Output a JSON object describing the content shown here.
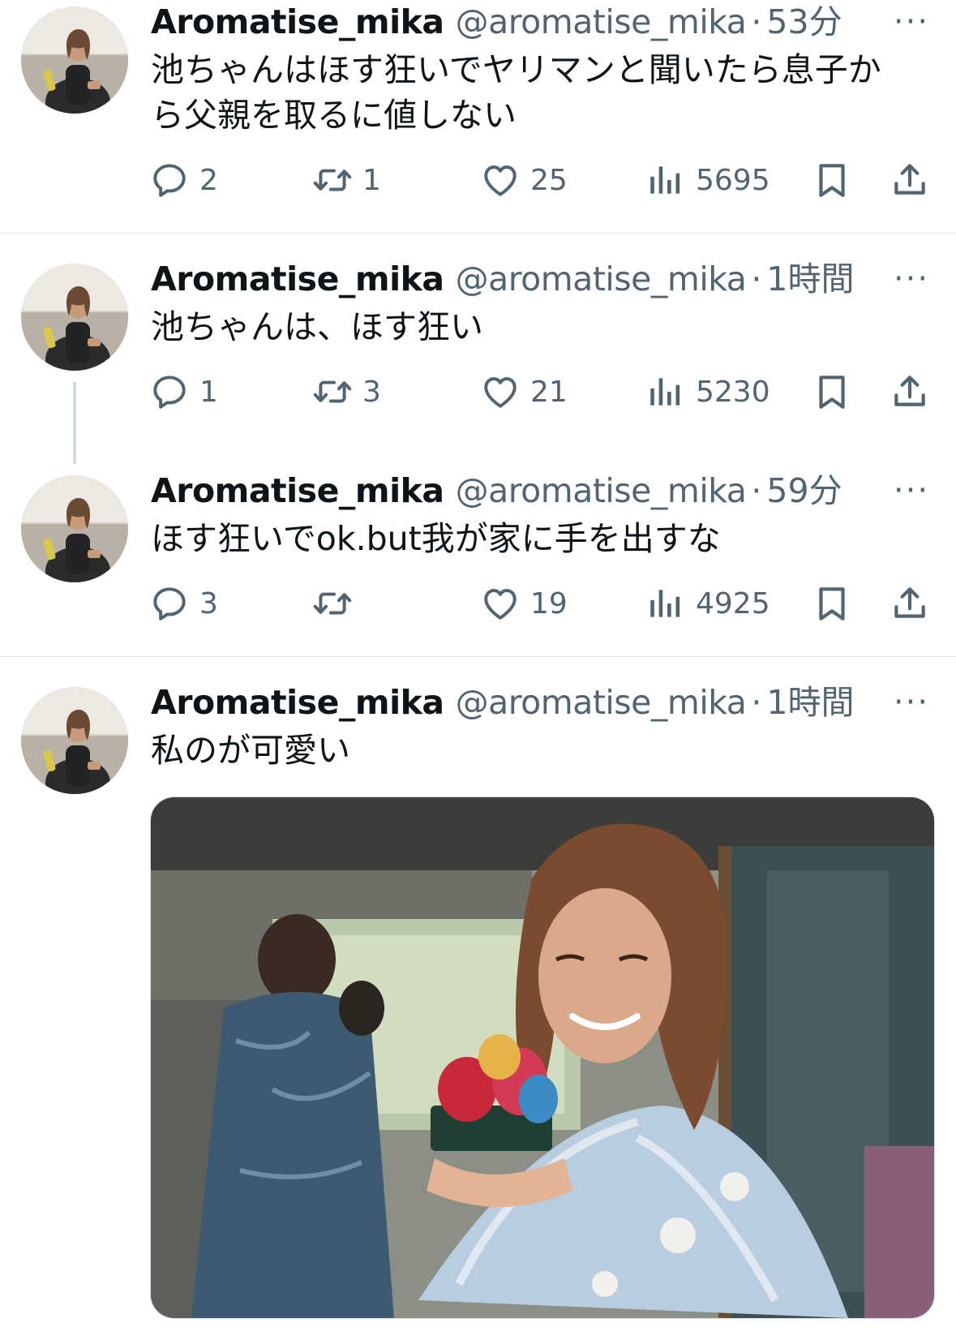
{
  "tweets": [
    {
      "name": "Aromatise_mika",
      "handle": "@aromatise_mika",
      "separator": "·",
      "time": "53分",
      "more": "···",
      "text": "池ちゃんはほす狂いでヤリマンと聞いたら息子から父親を取るに値しない",
      "replies": "2",
      "retweets": "1",
      "likes": "25",
      "views": "5695"
    },
    {
      "name": "Aromatise_mika",
      "handle": "@aromatise_mika",
      "separator": "·",
      "time": "1時間",
      "more": "···",
      "text": "池ちゃんは、ほす狂い",
      "replies": "1",
      "retweets": "3",
      "likes": "21",
      "views": "5230"
    },
    {
      "name": "Aromatise_mika",
      "handle": "@aromatise_mika",
      "separator": "·",
      "time": "59分",
      "more": "···",
      "text": "ほす狂いでok.but我が家に手を出すな",
      "replies": "3",
      "retweets": "",
      "likes": "19",
      "views": "4925"
    },
    {
      "name": "Aromatise_mika",
      "handle": "@aromatise_mika",
      "separator": "·",
      "time": "1時間",
      "more": "···",
      "text": "私のが可愛い"
    }
  ],
  "colors": {
    "text": "#0f1419",
    "secondary": "#536471",
    "divider": "#e3e6e8",
    "thread_line": "#cfd9de"
  },
  "icons": [
    "reply-icon",
    "retweet-icon",
    "like-icon",
    "views-icon",
    "bookmark-icon",
    "share-icon",
    "more-icon"
  ]
}
